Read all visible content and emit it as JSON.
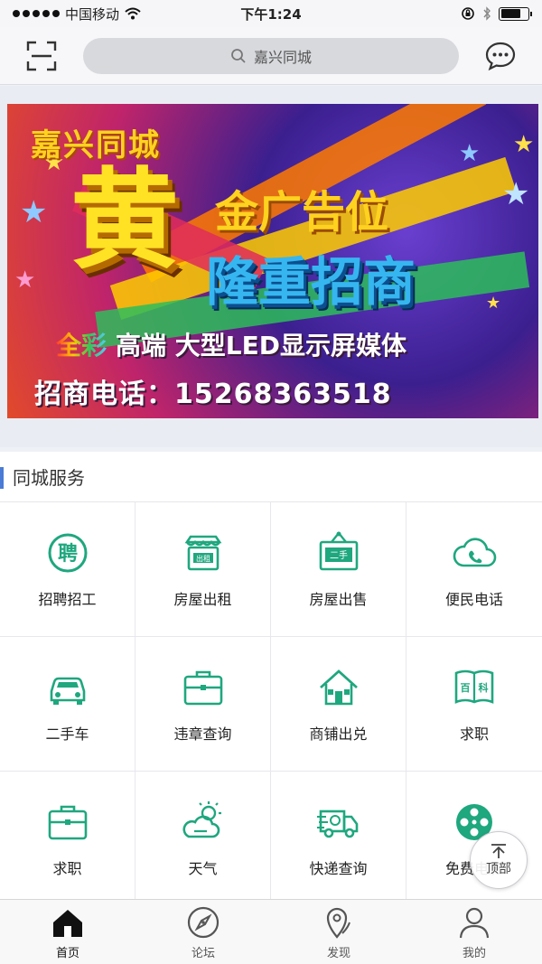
{
  "status_bar": {
    "carrier": "中国移动",
    "time": "下午1:24",
    "battery_level": 0.75
  },
  "header": {
    "scan_icon": "scan-icon",
    "search_placeholder": "嘉兴同城",
    "chat_icon": "chat-bubble-icon"
  },
  "banner": {
    "city": "嘉兴同城",
    "big_char": "黄",
    "line1": "金广告位",
    "line2": "隆重招商",
    "tag_color": "全彩",
    "tag_rest": "高端  大型LED显示屏媒体",
    "phone": "招商电话：15268363518"
  },
  "services": {
    "title": "同城服务",
    "accent_color": "#1fa77e",
    "items": [
      {
        "label": "招聘招工",
        "icon": "hire-icon"
      },
      {
        "label": "房屋出租",
        "icon": "house-rent-icon"
      },
      {
        "label": "房屋出售",
        "icon": "house-sale-icon"
      },
      {
        "label": "便民电话",
        "icon": "phone-cloud-icon"
      },
      {
        "label": "二手车",
        "icon": "car-icon"
      },
      {
        "label": "违章查询",
        "icon": "briefcase-icon"
      },
      {
        "label": "商铺出兑",
        "icon": "shop-icon"
      },
      {
        "label": "求职",
        "icon": "encyclopedia-book-icon"
      },
      {
        "label": "求职",
        "icon": "briefcase-icon"
      },
      {
        "label": "天气",
        "icon": "weather-icon"
      },
      {
        "label": "快递查询",
        "icon": "delivery-truck-icon"
      },
      {
        "label": "免费电影",
        "icon": "film-reel-icon"
      }
    ]
  },
  "to_top": {
    "label": "顶部"
  },
  "tabbar": {
    "items": [
      {
        "label": "首页",
        "icon": "home-icon",
        "active": true
      },
      {
        "label": "论坛",
        "icon": "compass-icon",
        "active": false
      },
      {
        "label": "发现",
        "icon": "location-pin-icon",
        "active": false
      },
      {
        "label": "我的",
        "icon": "user-icon",
        "active": false
      }
    ]
  }
}
